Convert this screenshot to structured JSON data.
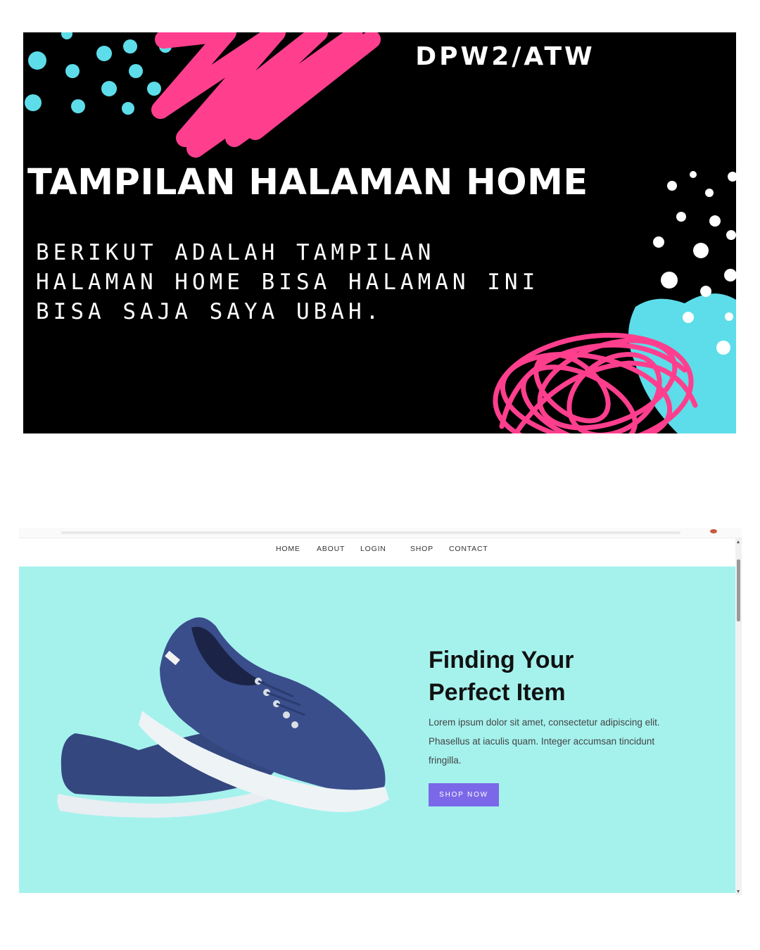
{
  "banner": {
    "tag": "DPW2/ATW",
    "title": "TAMPILAN HALAMAN HOME",
    "description": "BERIKUT ADALAH TAMPILAN HALAMAN HOME BISA HALAMAN INI BISA SAJA SAYA UBAH."
  },
  "nav": {
    "items": [
      "HOME",
      "ABOUT",
      "LOGIN",
      "SHOP",
      "CONTACT"
    ]
  },
  "hero": {
    "title_line1": "Finding Your",
    "title_line2": "Perfect Item",
    "text": "Lorem ipsum dolor sit amet, consectetur adipiscing elit. Phasellus at iaculis quam. Integer accumsan tincidunt fringilla.",
    "button": "SHOP NOW",
    "image": "blue-canvas-sneakers-photo"
  },
  "colors": {
    "banner_bg": "#000000",
    "accent_pink": "#ff3f8e",
    "accent_cyan": "#5ddde9",
    "hero_bg": "#a5f2ed",
    "button_bg": "#7a68e8",
    "shoe_blue": "#3a4e8c"
  }
}
